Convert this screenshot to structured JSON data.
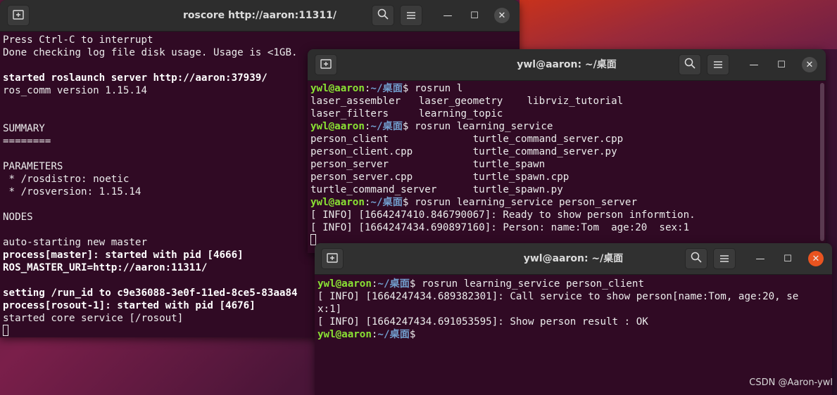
{
  "colors": {
    "terminal_bg": "#300a24",
    "prompt_user": "#8ae234",
    "prompt_path": "#729fcf",
    "close_active": "#e95420"
  },
  "win1": {
    "title": "roscore http://aaron:11311/",
    "lines": [
      {
        "t": "Press Ctrl-C to interrupt",
        "s": ""
      },
      {
        "t": "Done checking log file disk usage. Usage is <1GB.",
        "s": ""
      },
      {
        "t": "",
        "s": ""
      },
      {
        "t": "started roslaunch server http://aaron:37939/",
        "s": "b"
      },
      {
        "t": "ros_comm version 1.15.14",
        "s": ""
      },
      {
        "t": "",
        "s": ""
      },
      {
        "t": "",
        "s": ""
      },
      {
        "t": "SUMMARY",
        "s": ""
      },
      {
        "t": "========",
        "s": ""
      },
      {
        "t": "",
        "s": ""
      },
      {
        "t": "PARAMETERS",
        "s": ""
      },
      {
        "t": " * /rosdistro: noetic",
        "s": ""
      },
      {
        "t": " * /rosversion: 1.15.14",
        "s": ""
      },
      {
        "t": "",
        "s": ""
      },
      {
        "t": "NODES",
        "s": ""
      },
      {
        "t": "",
        "s": ""
      },
      {
        "t": "auto-starting new master",
        "s": ""
      },
      {
        "t": "process[master]: started with pid [4666]",
        "s": "b"
      },
      {
        "t": "ROS_MASTER_URI=http://aaron:11311/",
        "s": "b"
      },
      {
        "t": "",
        "s": ""
      },
      {
        "t": "setting /run_id to c9e36088-3e0f-11ed-8ce5-83aa84",
        "s": "b"
      },
      {
        "t": "process[rosout-1]: started with pid [4676]",
        "s": "b"
      },
      {
        "t": "started core service [/rosout]",
        "s": ""
      }
    ]
  },
  "win2": {
    "title": "ywl@aaron: ~/桌面",
    "prompt_user": "ywl@aaron",
    "prompt_sep": ":",
    "prompt_path": "~/桌面",
    "prompt_end": "$",
    "lines": [
      {
        "cmd": " rosrun l"
      },
      {
        "t": "laser_assembler   laser_geometry    librviz_tutorial"
      },
      {
        "t": "laser_filters     learning_topic"
      },
      {
        "cmd": " rosrun learning_service"
      },
      {
        "t": "person_client              turtle_command_server.cpp"
      },
      {
        "t": "person_client.cpp          turtle_command_server.py"
      },
      {
        "t": "person_server              turtle_spawn"
      },
      {
        "t": "person_server.cpp          turtle_spawn.cpp"
      },
      {
        "t": "turtle_command_server      turtle_spawn.py"
      },
      {
        "cmd": " rosrun learning_service person_server"
      },
      {
        "t": "[ INFO] [1664247410.846790067]: Ready to show person informtion."
      },
      {
        "t": "[ INFO] [1664247434.690897160]: Person: name:Tom  age:20  sex:1"
      }
    ]
  },
  "win3": {
    "title": "ywl@aaron: ~/桌面",
    "lines": [
      {
        "cmd": " rosrun learning_service person_client"
      },
      {
        "t": "[ INFO] [1664247434.689382301]: Call service to show person[name:Tom, age:20, se"
      },
      {
        "t": "x:1]"
      },
      {
        "t": "[ INFO] [1664247434.691053595]: Show person result : OK"
      },
      {
        "cmd": ""
      }
    ]
  },
  "watermark": "CSDN @Aaron-ywl",
  "icons": {
    "new_tab": "new-tab-icon",
    "search": "search-icon",
    "menu": "hamburger-menu-icon",
    "minimize": "minimize-icon",
    "maximize": "maximize-icon",
    "close": "close-icon"
  }
}
